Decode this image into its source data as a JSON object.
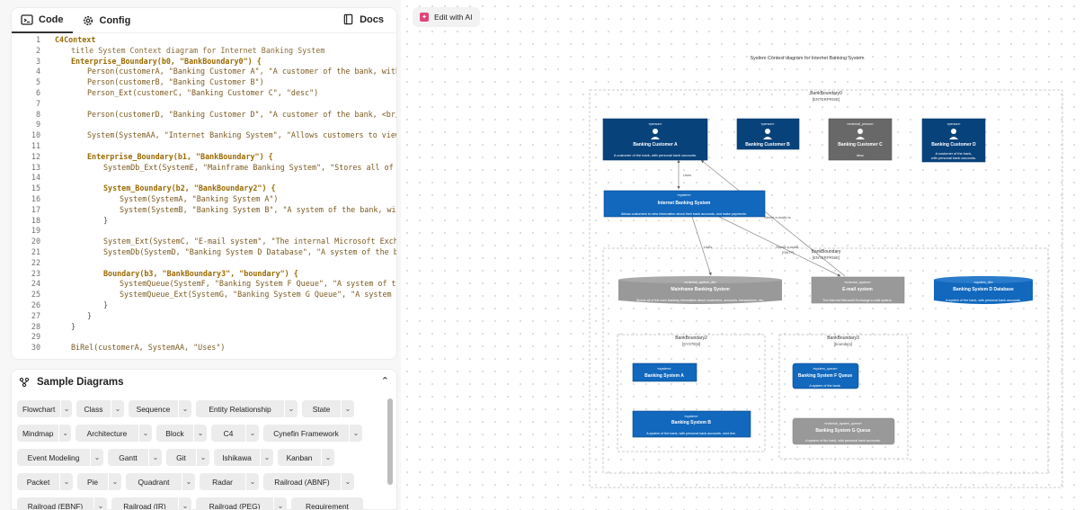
{
  "tabs": {
    "code": "Code",
    "config": "Config",
    "docs": "Docs"
  },
  "code_lines": [
    {
      "n": "1",
      "t": "C4Context",
      "i": 0
    },
    {
      "n": "2",
      "t": "title System Context diagram for Internet Banking System",
      "i": 1
    },
    {
      "n": "3",
      "t": "Enterprise_Boundary(b0, \"BankBoundary0\") {",
      "i": 1
    },
    {
      "n": "4",
      "t": "Person(customerA, \"Banking Customer A\", \"A customer of the bank, with pe",
      "i": 2
    },
    {
      "n": "5",
      "t": "Person(customerB, \"Banking Customer B\")",
      "i": 2
    },
    {
      "n": "6",
      "t": "Person_Ext(customerC, \"Banking Customer C\", \"desc\")",
      "i": 2
    },
    {
      "n": "7",
      "t": "",
      "i": 0
    },
    {
      "n": "8",
      "t": "Person(customerD, \"Banking Customer D\", \"A customer of the bank, <br/> w",
      "i": 2
    },
    {
      "n": "9",
      "t": "",
      "i": 0
    },
    {
      "n": "10",
      "t": "System(SystemAA, \"Internet Banking System\", \"Allows customers to view in",
      "i": 2
    },
    {
      "n": "11",
      "t": "",
      "i": 0
    },
    {
      "n": "12",
      "t": "Enterprise_Boundary(b1, \"BankBoundary\") {",
      "i": 2
    },
    {
      "n": "13",
      "t": "SystemDb_Ext(SystemE, \"Mainframe Banking System\", \"Stores all of the",
      "i": 3
    },
    {
      "n": "14",
      "t": "",
      "i": 0
    },
    {
      "n": "15",
      "t": "System_Boundary(b2, \"BankBoundary2\") {",
      "i": 3
    },
    {
      "n": "16",
      "t": "System(SystemA, \"Banking System A\")",
      "i": 4
    },
    {
      "n": "17",
      "t": "System(SystemB, \"Banking System B\", \"A system of the bank, with",
      "i": 4
    },
    {
      "n": "18",
      "t": "}",
      "i": 3
    },
    {
      "n": "19",
      "t": "",
      "i": 0
    },
    {
      "n": "20",
      "t": "System_Ext(SystemC, \"E-mail system\", \"The internal Microsoft Exchang",
      "i": 3
    },
    {
      "n": "21",
      "t": "SystemDb(SystemD, \"Banking System D Database\", \"A system of the bank",
      "i": 3
    },
    {
      "n": "22",
      "t": "",
      "i": 0
    },
    {
      "n": "23",
      "t": "Boundary(b3, \"BankBoundary3\", \"boundary\") {",
      "i": 3
    },
    {
      "n": "24",
      "t": "SystemQueue(SystemF, \"Banking System F Queue\", \"A system of the",
      "i": 4
    },
    {
      "n": "25",
      "t": "SystemQueue_Ext(SystemG, \"Banking System G Queue\", \"A system of",
      "i": 4
    },
    {
      "n": "26",
      "t": "}",
      "i": 3
    },
    {
      "n": "27",
      "t": "}",
      "i": 2
    },
    {
      "n": "28",
      "t": "}",
      "i": 1
    },
    {
      "n": "29",
      "t": "",
      "i": 0
    },
    {
      "n": "30",
      "t": "BiRel(customerA, SystemAA, \"Uses\")",
      "i": 1
    }
  ],
  "samples": {
    "title": "Sample Diagrams",
    "rows": [
      [
        {
          "label": "Flowchart",
          "arrow": true
        },
        {
          "label": "Class",
          "arrow": true
        },
        {
          "label": "Sequence",
          "arrow": true
        },
        {
          "label": "Entity Relationship",
          "arrow": true
        },
        {
          "label": "State",
          "arrow": true
        }
      ],
      [
        {
          "label": "Mindmap",
          "arrow": true
        },
        {
          "label": "Architecture",
          "arrow": true
        },
        {
          "label": "Block",
          "arrow": true
        },
        {
          "label": "C4",
          "arrow": true
        },
        {
          "label": "Cynefin Framework",
          "arrow": true
        }
      ],
      [
        {
          "label": "Event Modeling",
          "arrow": true
        },
        {
          "label": "Gantt",
          "arrow": true
        },
        {
          "label": "Git",
          "arrow": true
        },
        {
          "label": "Ishikawa",
          "arrow": true
        },
        {
          "label": "Kanban",
          "arrow": true
        }
      ],
      [
        {
          "label": "Packet",
          "arrow": true
        },
        {
          "label": "Pie",
          "arrow": true
        },
        {
          "label": "Quadrant",
          "arrow": true
        },
        {
          "label": "Radar",
          "arrow": true
        },
        {
          "label": "Railroad (ABNF)",
          "arrow": true
        }
      ],
      [
        {
          "label": "Railroad (EBNF)",
          "arrow": true
        },
        {
          "label": "Railroad (IR)",
          "arrow": true
        },
        {
          "label": "Railroad (PEG)",
          "arrow": true
        },
        {
          "label": "Requirement",
          "arrow": false
        }
      ]
    ]
  },
  "edit_ai": "Edit with AI",
  "diagram": {
    "title": "System Context diagram for Internet Banking System",
    "b0": {
      "name": "BankBoundary0",
      "tag": "[ENTERPRISE]"
    },
    "b1": {
      "name": "BankBoundary",
      "tag": "[ENTERPRISE]"
    },
    "b2": {
      "name": "BankBoundary2",
      "tag": "[SYSTEM]"
    },
    "b3": {
      "name": "BankBoundary3",
      "tag": "[boundary]"
    },
    "customerA": {
      "stereo": "«person»",
      "name": "Banking Customer A",
      "desc": "A customer of the bank, with personal bank accounts."
    },
    "customerB": {
      "stereo": "«person»",
      "name": "Banking Customer B"
    },
    "customerC": {
      "stereo": "«external_person»",
      "name": "Banking Customer C",
      "desc": "desc"
    },
    "customerD": {
      "stereo": "«person»",
      "name": "Banking Customer D",
      "desc1": "A customer of the bank,",
      "desc2": "with personal bank accounts."
    },
    "systemAA": {
      "stereo": "«system»",
      "name": "Internet Banking System",
      "desc": "Allows customers to view information about their bank accounts, and make payments."
    },
    "systemE": {
      "stereo": "«external_system_db»",
      "name": "Mainframe Banking System",
      "desc": "Stores all of the core banking information about customers, accounts, transactions, etc."
    },
    "systemC": {
      "stereo": "«external_system»",
      "name": "E-mail system",
      "desc": "The internal Microsoft Exchange e-mail system."
    },
    "systemD": {
      "stereo": "«system_db»",
      "name": "Banking System D Database",
      "desc": "A system of the bank, with personal bank accounts."
    },
    "systemA": {
      "stereo": "«system»",
      "name": "Banking System A"
    },
    "systemB": {
      "stereo": "«system»",
      "name": "Banking System B",
      "desc": "A system of the bank, with personal bank accounts. next line."
    },
    "systemF": {
      "stereo": "«system_queue»",
      "name": "Banking System F Queue",
      "desc": "A system of the bank."
    },
    "systemG": {
      "stereo": "«external_system_queue»",
      "name": "Banking System G Queue",
      "desc": "A system of the bank, with personal bank accounts."
    },
    "rels": {
      "uses1": "Uses",
      "uses2": "Uses",
      "sends": "Sends e-mails",
      "sends_to": "Sends e-mails to",
      "sends_sub": "[SMTP]"
    },
    "colors": {
      "person": "#08427b",
      "system": "#1168bd",
      "ext": "#999999",
      "ext_person": "#686868"
    }
  }
}
